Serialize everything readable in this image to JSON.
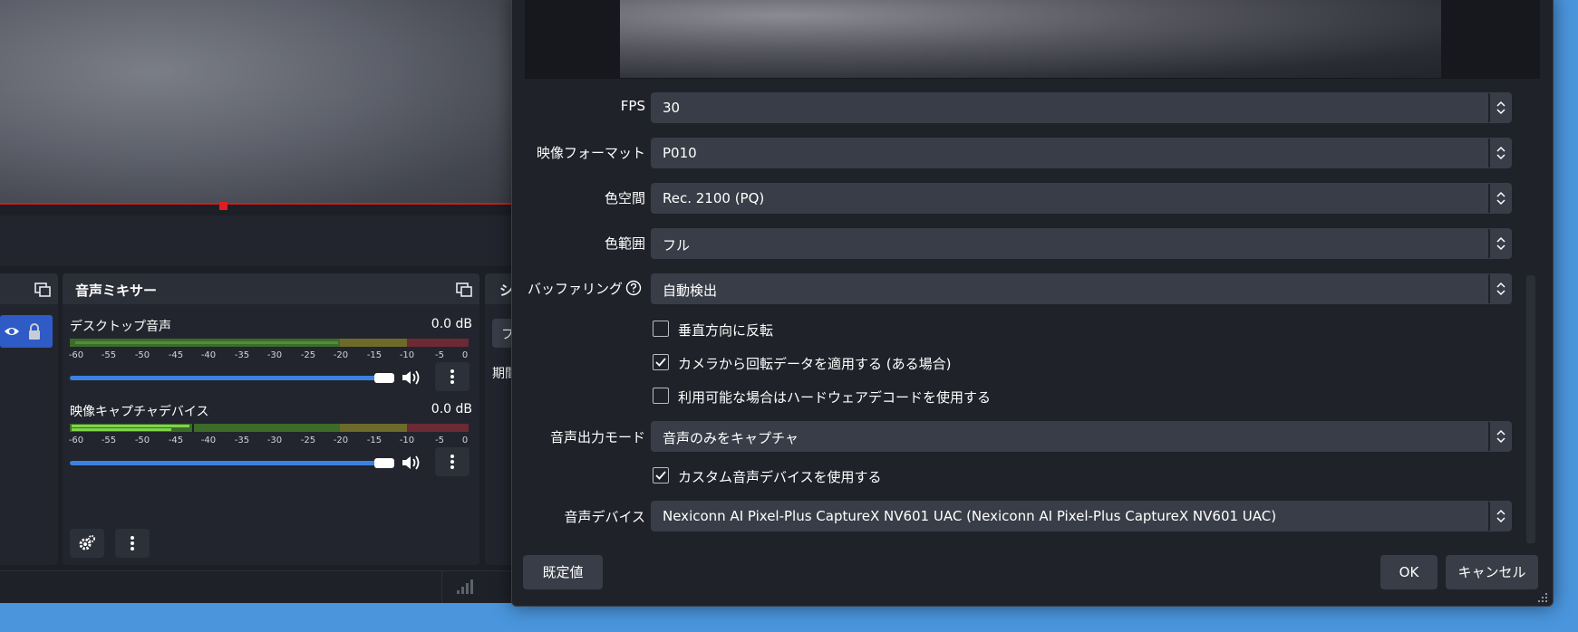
{
  "obs_main": {
    "mixer": {
      "title": "音声ミキサー",
      "channels": [
        {
          "name": "デスクトップ音声",
          "level": "0.0 dB"
        },
        {
          "name": "映像キャプチャデバイス",
          "level": "0.0 dB"
        }
      ],
      "meter_ticks": [
        "-60",
        "-55",
        "-50",
        "-45",
        "-40",
        "-35",
        "-30",
        "-25",
        "-20",
        "-15",
        "-10",
        "-5",
        "0"
      ]
    },
    "partial_dock_title": "シ",
    "partial_text": "期間",
    "partial_button": "フ"
  },
  "dialog": {
    "fields": {
      "fps": {
        "label": "FPS",
        "value": "30"
      },
      "video_format": {
        "label": "映像フォーマット",
        "value": "P010"
      },
      "color_space": {
        "label": "色空間",
        "value": "Rec. 2100 (PQ)"
      },
      "color_range": {
        "label": "色範囲",
        "value": "フル"
      },
      "buffering": {
        "label": "バッファリング",
        "value": "自動検出"
      },
      "audio_output_mode": {
        "label": "音声出力モード",
        "value": "音声のみをキャプチャ"
      },
      "audio_device": {
        "label": "音声デバイス",
        "value": "Nexiconn AI Pixel-Plus CaptureX NV601 UAC (Nexiconn AI Pixel-Plus CaptureX NV601 UAC)"
      }
    },
    "checkboxes": {
      "flip_vertical": {
        "label": "垂直方向に反転",
        "checked": false
      },
      "apply_rotation": {
        "label": "カメラから回転データを適用する (ある場合)",
        "checked": true
      },
      "hw_decode": {
        "label": "利用可能な場合はハードウェアデコードを使用する",
        "checked": false
      },
      "custom_audio": {
        "label": "カスタム音声デバイスを使用する",
        "checked": true
      }
    },
    "buttons": {
      "defaults": "既定値",
      "ok": "OK",
      "cancel": "キャンセル"
    }
  },
  "colors": {
    "accent_blue": "#3b82e0",
    "selection_blue": "#2f5bc7",
    "preview_border_red": "#d41c1c",
    "desktop_blue": "#4a95dc"
  }
}
